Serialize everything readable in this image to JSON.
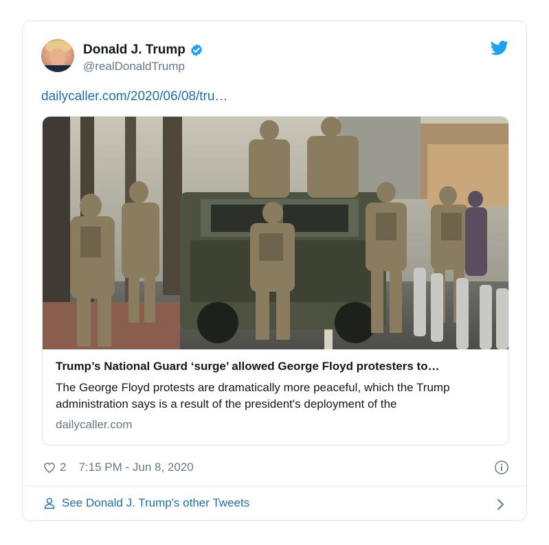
{
  "tweet": {
    "author_name": "Donald J. Trump",
    "author_handle": "@realDonaldTrump",
    "link_text": "dailycaller.com/2020/06/08/tru…",
    "likes": "2",
    "timestamp": "7:15 PM - Jun 8, 2020"
  },
  "link_card": {
    "title": "Trump’s National Guard ‘surge’ allowed George Floyd protesters to…",
    "description": "The George Floyd protests are dramatically more peaceful, which the Trump administration says is a result of the president's deployment of the",
    "domain": "dailycaller.com"
  },
  "footer": {
    "see_more": "See Donald J. Trump's other Tweets"
  },
  "icons": {
    "verified": "verified-badge-icon",
    "twitter": "twitter-bird-icon",
    "like": "heart-icon",
    "info": "info-icon",
    "profile": "person-icon",
    "chevron": "chevron-right-icon"
  },
  "colors": {
    "link": "#1b6fa8",
    "verified": "#1da1f2",
    "muted": "#657786",
    "border": "#dfe3e7"
  }
}
